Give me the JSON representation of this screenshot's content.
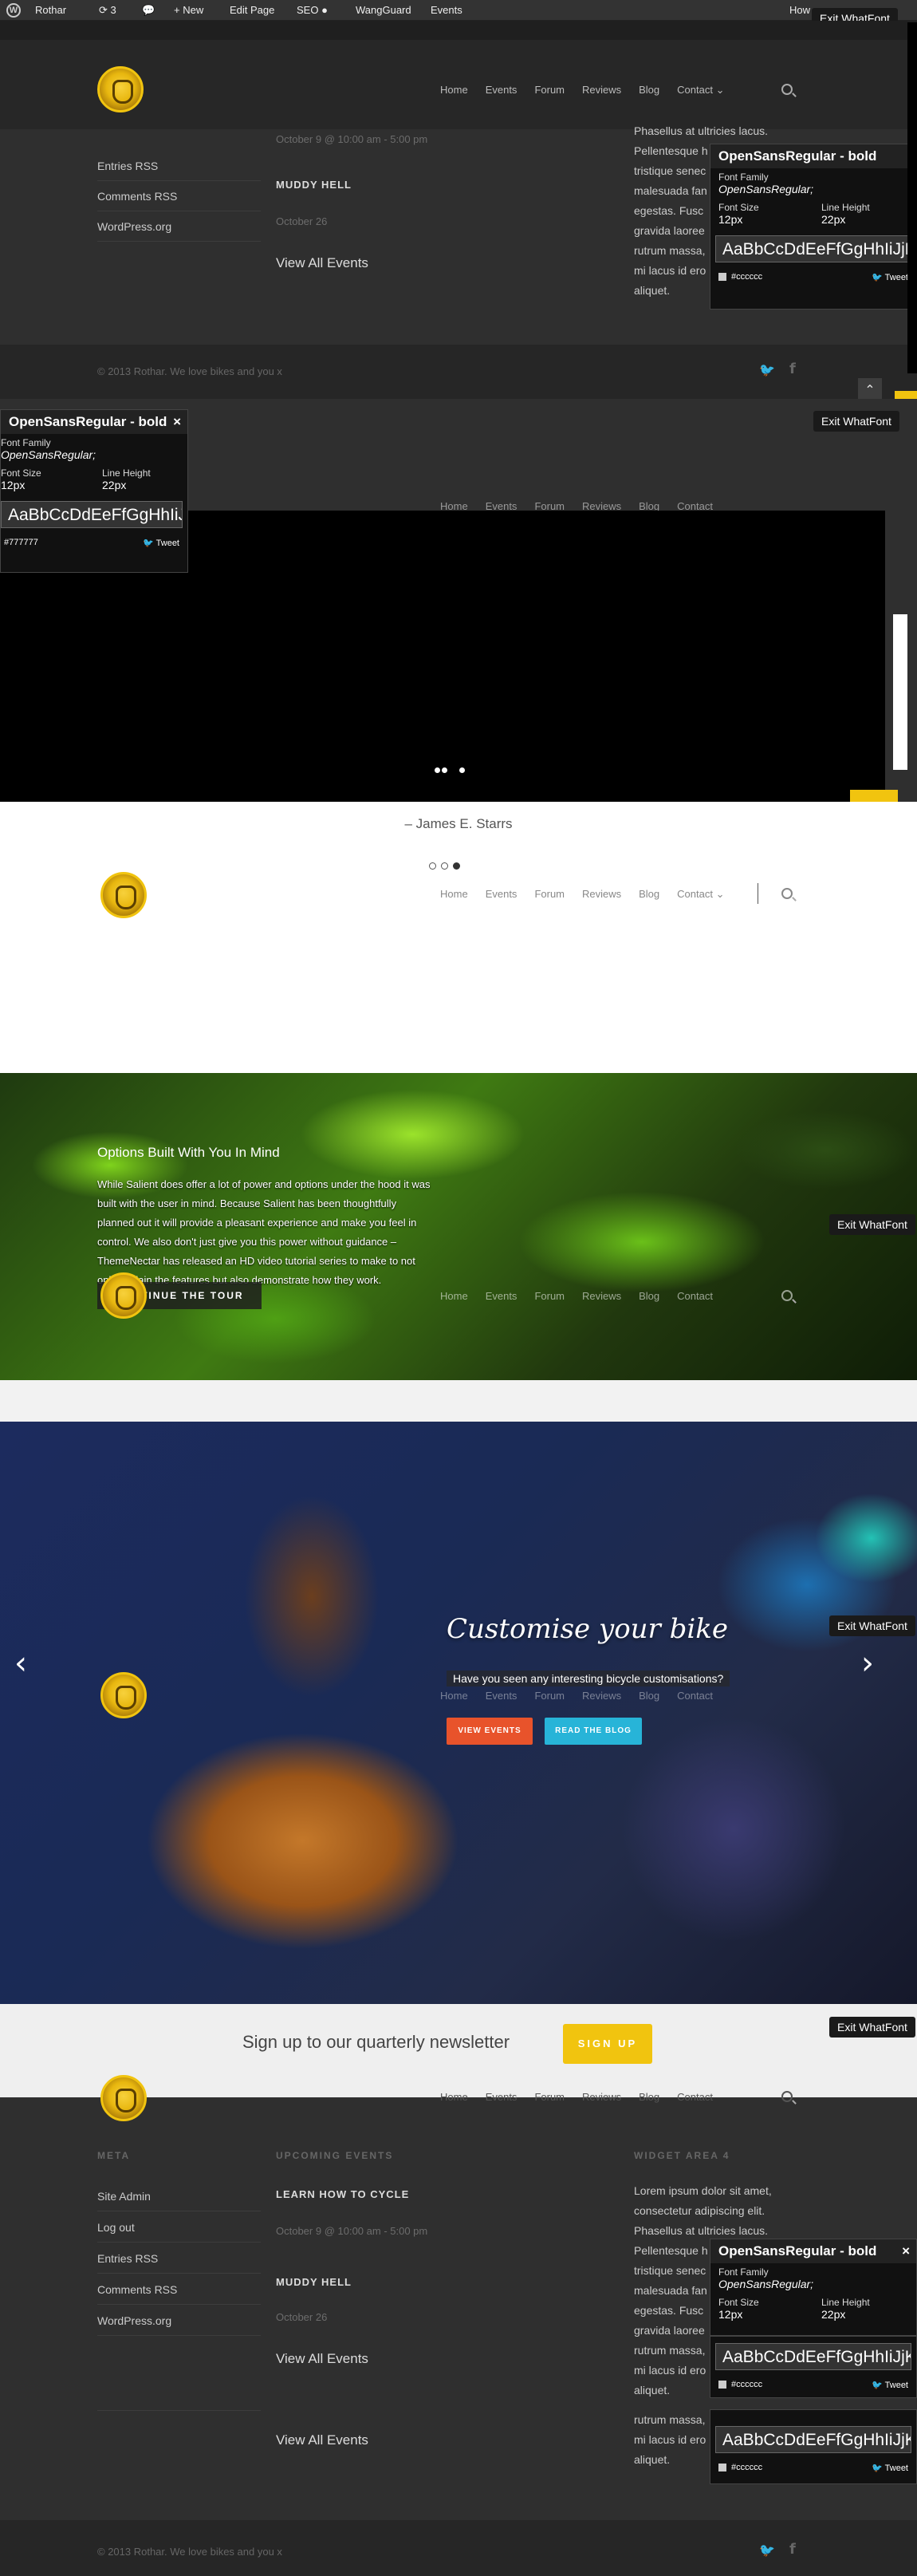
{
  "admin_bar": {
    "site": "Rothar",
    "updates": "3",
    "new": "New",
    "edit": "Edit Page",
    "seo": "SEO",
    "wangguard": "WangGuard",
    "events": "Events",
    "howdy": "How"
  },
  "whatfont": {
    "exit": "Exit WhatFont",
    "exit_short": "Exit WhatFont",
    "name": "OpenSansRegular - bold",
    "family_label": "Font Family",
    "family_value": "OpenSansRegular;",
    "size_label": "Font Size",
    "size_value": "12px",
    "lh_label": "Line Height",
    "lh_value": "22px",
    "sample": "AaBbCcDdEeFfGgHhIiJjKk",
    "color1": "#cccccc",
    "color2": "#777777",
    "tweet": "Tweet",
    "close": "×"
  },
  "nav": {
    "items": [
      "Home",
      "Events",
      "Forum",
      "Reviews",
      "Blog",
      "Contact"
    ],
    "caret": "⌄"
  },
  "footer_top": {
    "links": [
      "Entries RSS",
      "Comments RSS",
      "WordPress.org"
    ],
    "event1_date": "October 9 @ 10:00 am - 5:00 pm",
    "event2_title": "MUDDY HELL",
    "event2_date": "October 26",
    "view_all": "View All Events",
    "lorem_lines": [
      "Phasellus at ultricies lacus.",
      "Pellentesque h",
      "tristique senec",
      "malesuada fan",
      "egestas. Fusc",
      "gravida laoree",
      "rutrum massa,",
      "mi lacus id ero",
      "aliquet."
    ],
    "copyright": "© 2013 Rothar. We love bikes and you x"
  },
  "testimonial": {
    "author": "– James E. Starrs"
  },
  "tour": {
    "title": "Options Built With You In Mind",
    "body": "While Salient does offer a lot of power and options under the hood it was built with the user in mind. Because Salient has been thoughtfully planned out it will provide a pleasant experience and make you feel in control. We also don't just give you this power without guidance – ThemeNectar has released an HD video tutorial series to make to not only explain the features but also demonstrate how they work.",
    "button": "CONTINUE THE TOUR"
  },
  "slider": {
    "heading": "Customise your bike",
    "sub": "Have you seen any interesting bicycle customisations?",
    "btn1": "VIEW EVENTS",
    "btn2": "READ THE BLOG",
    "prev": "‹",
    "next": "›",
    "btn1_color": "#e8532b",
    "btn2_color": "#27b4d8"
  },
  "newsletter": {
    "text": "Sign up to our quarterly newsletter",
    "button": "SIGN UP",
    "button_color": "#f1c40f"
  },
  "footer": {
    "meta_title": "META",
    "meta_links": [
      "Site Admin",
      "Log out",
      "Entries RSS",
      "Comments RSS",
      "WordPress.org"
    ],
    "events_title": "UPCOMING EVENTS",
    "event1_title": "LEARN HOW TO CYCLE",
    "event1_date": "October 9 @ 10:00 am - 5:00 pm",
    "event2_title": "MUDDY HELL",
    "event2_date": "October 26",
    "view_all": "View All Events",
    "widget4_title": "WIDGET AREA 4",
    "lorem_lines": [
      "Lorem ipsum dolor sit amet,",
      "consectetur adipiscing elit.",
      "Phasellus at ultricies lacus.",
      "Pellentesque h",
      "tristique senec",
      "malesuada fan",
      "egestas. Fusc",
      "gravida laoree",
      "rutrum massa,",
      "mi lacus id ero",
      "aliquet."
    ],
    "lorem2_lines": [
      "rutrum massa,",
      "mi lacus id ero",
      "aliquet."
    ],
    "copyright": "© 2013 Rothar. We love bikes and you x"
  },
  "icons": {
    "twitter": "🐦",
    "facebook": "f",
    "up": "⌃"
  }
}
